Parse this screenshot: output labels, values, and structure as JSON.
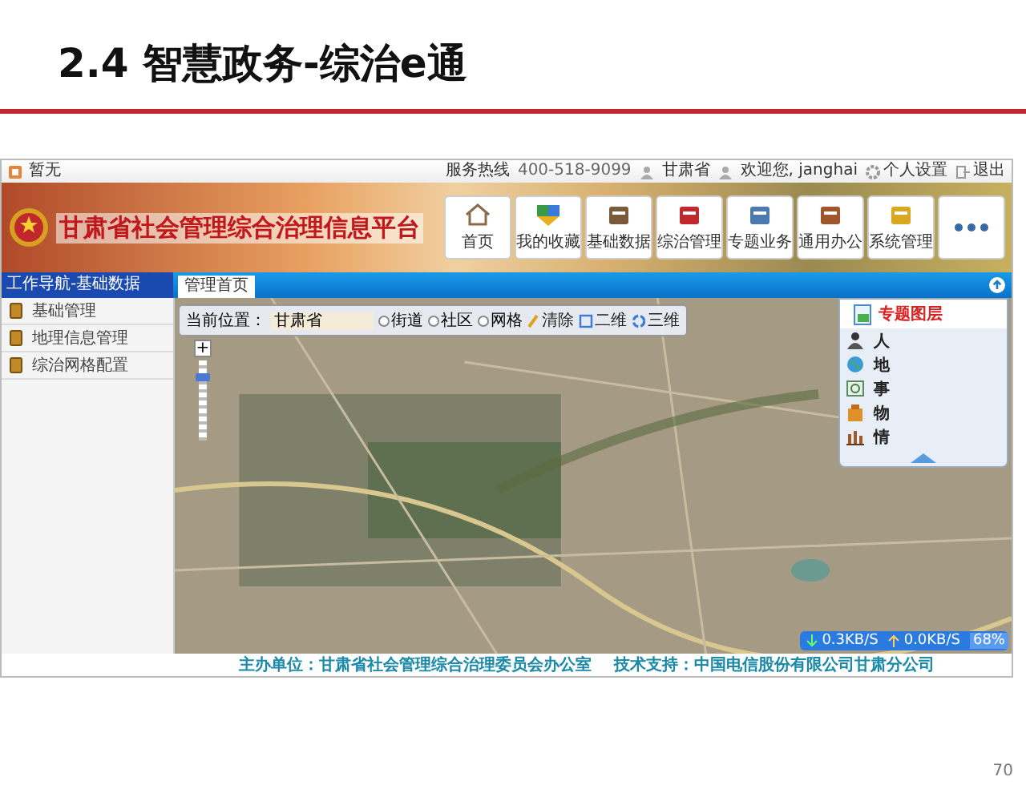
{
  "slide": {
    "title": "2.4 智慧政务-综治e通",
    "page_number": "70"
  },
  "top_bar": {
    "notice": "暂无",
    "hotline_label": "服务热线",
    "hotline": "400-518-9099",
    "region": "甘肃省",
    "welcome": "欢迎您, janghai",
    "settings": "个人设置",
    "logout": "退出"
  },
  "banner": {
    "title": "甘肃省社会管理综合治理信息平台"
  },
  "nav": [
    {
      "label": "首页",
      "kind": "home"
    },
    {
      "label": "我的收藏",
      "kind": "favorites"
    },
    {
      "label": "基础数据",
      "kind": "data"
    },
    {
      "label": "综治管理",
      "kind": "manage"
    },
    {
      "label": "专题业务",
      "kind": "topic"
    },
    {
      "label": "通用办公",
      "kind": "office"
    },
    {
      "label": "系统管理",
      "kind": "system"
    },
    {
      "kind": "more"
    }
  ],
  "sidebar": {
    "title": "工作导航-基础数据",
    "items": [
      {
        "label": "基础管理"
      },
      {
        "label": "地理信息管理"
      },
      {
        "label": "综治网格配置"
      }
    ]
  },
  "tabs": [
    {
      "label": "管理首页",
      "selected": true
    }
  ],
  "map": {
    "location_label": "当前位置：",
    "location": "甘肃省",
    "radios": [
      {
        "label": "街道",
        "selected": false
      },
      {
        "label": "社区",
        "selected": false
      },
      {
        "label": "网格",
        "selected": false
      }
    ],
    "clear": "清除",
    "views": [
      {
        "label": "二维",
        "kind": "flat"
      },
      {
        "label": "三维",
        "kind": "globe"
      }
    ],
    "zoom": {
      "label": "+",
      "level": 0.85
    },
    "layers": {
      "title": "专题图层",
      "items": [
        {
          "label": "人",
          "kind": "person"
        },
        {
          "label": "地",
          "kind": "globe"
        },
        {
          "label": "事",
          "kind": "event"
        },
        {
          "label": "物",
          "kind": "box"
        },
        {
          "label": "情",
          "kind": "chart"
        }
      ]
    },
    "speed": {
      "down": "0.3KB/S",
      "up": "0.0KB/S",
      "percent": "68%"
    }
  },
  "footer": {
    "sponsor": "主办单位：甘肃省社会管理综合治理委员会办公室",
    "support": "技术支持：中国电信股份有限公司甘肃分公司"
  }
}
